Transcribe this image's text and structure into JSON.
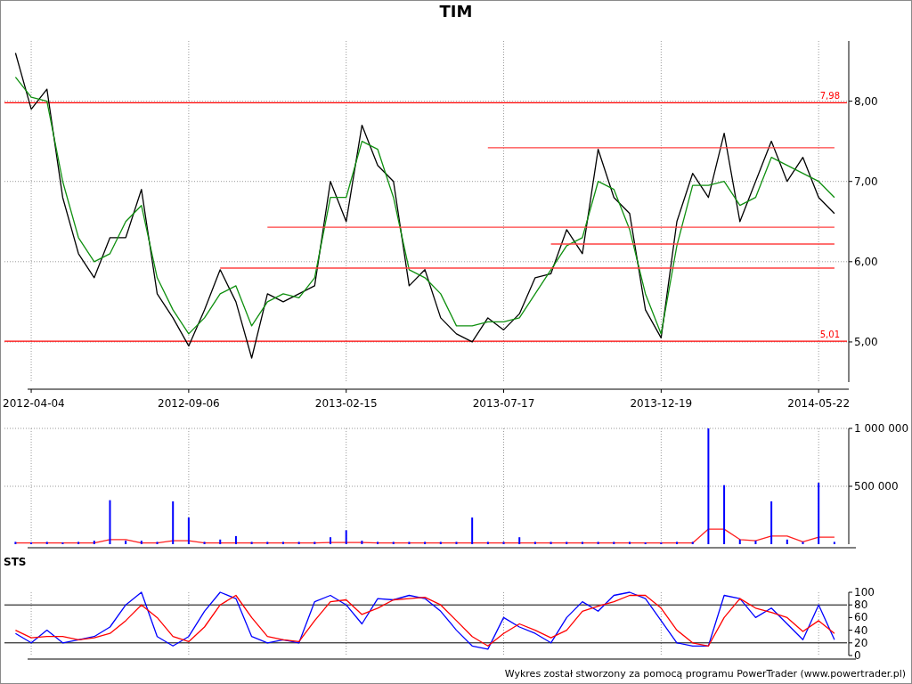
{
  "price_panel": {
    "chart_data": {
      "type": "line",
      "title": "TIM",
      "categories": [
        null,
        "2012-04-04",
        null,
        null,
        null,
        null,
        null,
        null,
        null,
        null,
        null,
        "2012-09-06",
        null,
        null,
        null,
        null,
        null,
        null,
        null,
        null,
        null,
        "2013-02-15",
        null,
        null,
        null,
        null,
        null,
        null,
        null,
        null,
        null,
        "2013-07-17",
        null,
        null,
        null,
        null,
        null,
        null,
        null,
        null,
        null,
        "2013-12-19",
        null,
        null,
        null,
        null,
        null,
        null,
        null,
        null,
        null,
        "2014-05-22",
        null
      ],
      "series": [
        {
          "color": "#000000",
          "values": [
            8.6,
            7.9,
            8.15,
            6.8,
            6.1,
            5.8,
            6.3,
            6.3,
            6.9,
            5.6,
            5.3,
            4.95,
            5.4,
            5.9,
            5.5,
            4.8,
            5.6,
            5.5,
            5.6,
            5.7,
            7.0,
            6.5,
            7.7,
            7.2,
            7.0,
            5.7,
            5.9,
            5.3,
            5.1,
            5.0,
            5.3,
            5.15,
            5.35,
            5.8,
            5.85,
            6.4,
            6.1,
            7.4,
            6.8,
            6.6,
            5.4,
            5.05,
            6.5,
            7.1,
            6.8,
            7.6,
            6.5,
            7.0,
            7.5,
            7.0,
            7.3,
            6.8,
            6.6
          ]
        },
        {
          "color": "#109010",
          "values": [
            8.3,
            8.05,
            8.0,
            7.0,
            6.3,
            6.0,
            6.1,
            6.5,
            6.7,
            5.8,
            5.4,
            5.1,
            5.3,
            5.6,
            5.7,
            5.2,
            5.5,
            5.6,
            5.55,
            5.8,
            6.8,
            6.8,
            7.5,
            7.4,
            6.8,
            5.9,
            5.8,
            5.6,
            5.2,
            5.2,
            5.25,
            5.25,
            5.3,
            5.6,
            5.9,
            6.2,
            6.3,
            7.0,
            6.9,
            6.4,
            5.6,
            5.1,
            6.2,
            6.95,
            6.95,
            7.0,
            6.7,
            6.8,
            7.3,
            7.2,
            7.1,
            7.0,
            6.8
          ]
        },
        {
          "color": "#ff4040",
          "values": [
            null,
            null,
            null,
            null,
            null,
            null,
            null,
            null,
            null,
            null,
            null,
            null,
            null,
            null,
            null,
            null,
            null,
            null,
            null,
            null,
            null,
            null,
            null,
            null,
            null,
            null,
            null,
            null,
            null,
            null,
            7.42,
            7.42,
            7.42,
            7.42,
            7.42,
            7.42,
            7.42,
            7.42,
            7.42,
            7.42,
            7.42,
            7.42,
            7.42,
            7.42,
            7.42,
            7.42,
            7.42,
            7.42,
            7.42,
            7.42,
            7.42,
            7.42,
            7.42
          ]
        },
        {
          "color": "#ff4040",
          "values": [
            null,
            null,
            null,
            null,
            null,
            null,
            null,
            null,
            null,
            null,
            null,
            null,
            null,
            null,
            null,
            null,
            6.43,
            6.43,
            6.43,
            6.43,
            6.43,
            6.43,
            6.43,
            6.43,
            6.43,
            6.43,
            6.43,
            6.43,
            6.43,
            6.43,
            6.43,
            6.43,
            6.43,
            6.43,
            6.43,
            6.43,
            6.43,
            6.43,
            6.43,
            6.43,
            6.43,
            6.43,
            6.43,
            6.43,
            6.43,
            6.43,
            6.43,
            6.43,
            6.43,
            6.43,
            6.43,
            6.43,
            6.43
          ]
        },
        {
          "color": "#ff4040",
          "values": [
            null,
            null,
            null,
            null,
            null,
            null,
            null,
            null,
            null,
            null,
            null,
            null,
            null,
            null,
            null,
            null,
            null,
            null,
            null,
            null,
            null,
            null,
            null,
            null,
            null,
            null,
            null,
            null,
            null,
            null,
            null,
            null,
            null,
            null,
            6.22,
            6.22,
            6.22,
            6.22,
            6.22,
            6.22,
            6.22,
            6.22,
            6.22,
            6.22,
            6.22,
            6.22,
            6.22,
            6.22,
            6.22,
            6.22,
            6.22,
            6.22,
            6.22
          ]
        },
        {
          "color": "#ff4040",
          "values": [
            null,
            null,
            null,
            null,
            null,
            null,
            null,
            null,
            null,
            null,
            null,
            null,
            null,
            5.92,
            5.92,
            5.92,
            5.92,
            5.92,
            5.92,
            5.92,
            5.92,
            5.92,
            5.92,
            5.92,
            5.92,
            5.92,
            5.92,
            5.92,
            5.92,
            5.92,
            5.92,
            5.92,
            5.92,
            5.92,
            5.92,
            5.92,
            5.92,
            5.92,
            5.92,
            5.92,
            5.92,
            5.92,
            5.92,
            5.92,
            5.92,
            5.92,
            5.92,
            5.92,
            5.92,
            5.92,
            5.92,
            5.92,
            5.92
          ]
        }
      ],
      "ylim": [
        4.5,
        8.75
      ],
      "grid": true,
      "yticks": [
        {
          "value": 5,
          "label": "5,00"
        },
        {
          "value": 6,
          "label": "6,00"
        },
        {
          "value": 7,
          "label": "7,00"
        },
        {
          "value": 8,
          "label": "8,00"
        }
      ],
      "ref_lines": [
        {
          "axis": "y",
          "value": 7.98,
          "label": "7,98"
        },
        {
          "axis": "y",
          "value": 5.01,
          "label": "5,01"
        }
      ]
    }
  },
  "volume_panel": {
    "chart_data": {
      "type": "bar",
      "series": [
        {
          "color": "#0000ff",
          "values": [
            20000,
            15000,
            20000,
            15000,
            20000,
            30000,
            380000,
            30000,
            30000,
            20000,
            370000,
            230000,
            20000,
            40000,
            70000,
            20000,
            20000,
            20000,
            20000,
            20000,
            60000,
            120000,
            30000,
            20000,
            20000,
            20000,
            20000,
            20000,
            20000,
            230000,
            20000,
            20000,
            60000,
            20000,
            20000,
            20000,
            20000,
            20000,
            20000,
            20000,
            15000,
            15000,
            20000,
            20000,
            1000000,
            510000,
            40000,
            30000,
            370000,
            40000,
            20000,
            530000,
            20000
          ]
        },
        {
          "type": "line",
          "color": "#ff2020",
          "values": [
            10000,
            10000,
            10000,
            10000,
            10000,
            10000,
            40000,
            40000,
            10000,
            10000,
            30000,
            30000,
            10000,
            10000,
            10000,
            10000,
            10000,
            10000,
            10000,
            10000,
            15000,
            15000,
            15000,
            10000,
            10000,
            10000,
            10000,
            10000,
            10000,
            10000,
            10000,
            10000,
            10000,
            10000,
            10000,
            10000,
            10000,
            10000,
            10000,
            10000,
            10000,
            10000,
            10000,
            10000,
            130000,
            130000,
            40000,
            30000,
            70000,
            70000,
            20000,
            60000,
            60000
          ]
        }
      ],
      "ylim": [
        0,
        1000000
      ],
      "grid": true,
      "yticks": [
        {
          "value": 500000,
          "label": "500 000"
        },
        {
          "value": 1000000,
          "label": "1 000 000"
        }
      ]
    }
  },
  "sts_panel": {
    "chart_data": {
      "type": "line",
      "title": "STS",
      "series": [
        {
          "color": "#0000ff",
          "values": [
            35,
            20,
            40,
            20,
            25,
            30,
            45,
            80,
            100,
            30,
            15,
            30,
            70,
            100,
            90,
            30,
            20,
            25,
            20,
            85,
            95,
            80,
            50,
            90,
            88,
            95,
            90,
            70,
            40,
            15,
            10,
            60,
            45,
            35,
            20,
            60,
            85,
            70,
            95,
            100,
            90,
            55,
            20,
            15,
            15,
            95,
            90,
            60,
            75,
            50,
            25,
            80,
            25
          ]
        },
        {
          "color": "#ff0000",
          "values": [
            40,
            28,
            30,
            30,
            25,
            28,
            35,
            55,
            80,
            60,
            30,
            22,
            45,
            80,
            95,
            60,
            30,
            25,
            22,
            55,
            85,
            88,
            65,
            75,
            88,
            90,
            92,
            80,
            55,
            30,
            15,
            35,
            50,
            40,
            28,
            40,
            70,
            78,
            85,
            95,
            95,
            75,
            40,
            20,
            15,
            60,
            90,
            75,
            68,
            60,
            38,
            55,
            35
          ]
        }
      ],
      "ylim": [
        0,
        100
      ],
      "grid": true,
      "yticks": [
        {
          "value": 0,
          "label": "0"
        },
        {
          "value": 20,
          "label": "20"
        },
        {
          "value": 40,
          "label": "40"
        },
        {
          "value": 60,
          "label": "60"
        },
        {
          "value": 80,
          "label": "80"
        },
        {
          "value": 100,
          "label": "100"
        }
      ],
      "ref_lines": [
        {
          "axis": "y",
          "value": 80
        },
        {
          "axis": "y",
          "value": 20
        }
      ]
    }
  },
  "footer": "Wykres został stworzony za pomocą programu PowerTrader (www.powertrader.pl)"
}
